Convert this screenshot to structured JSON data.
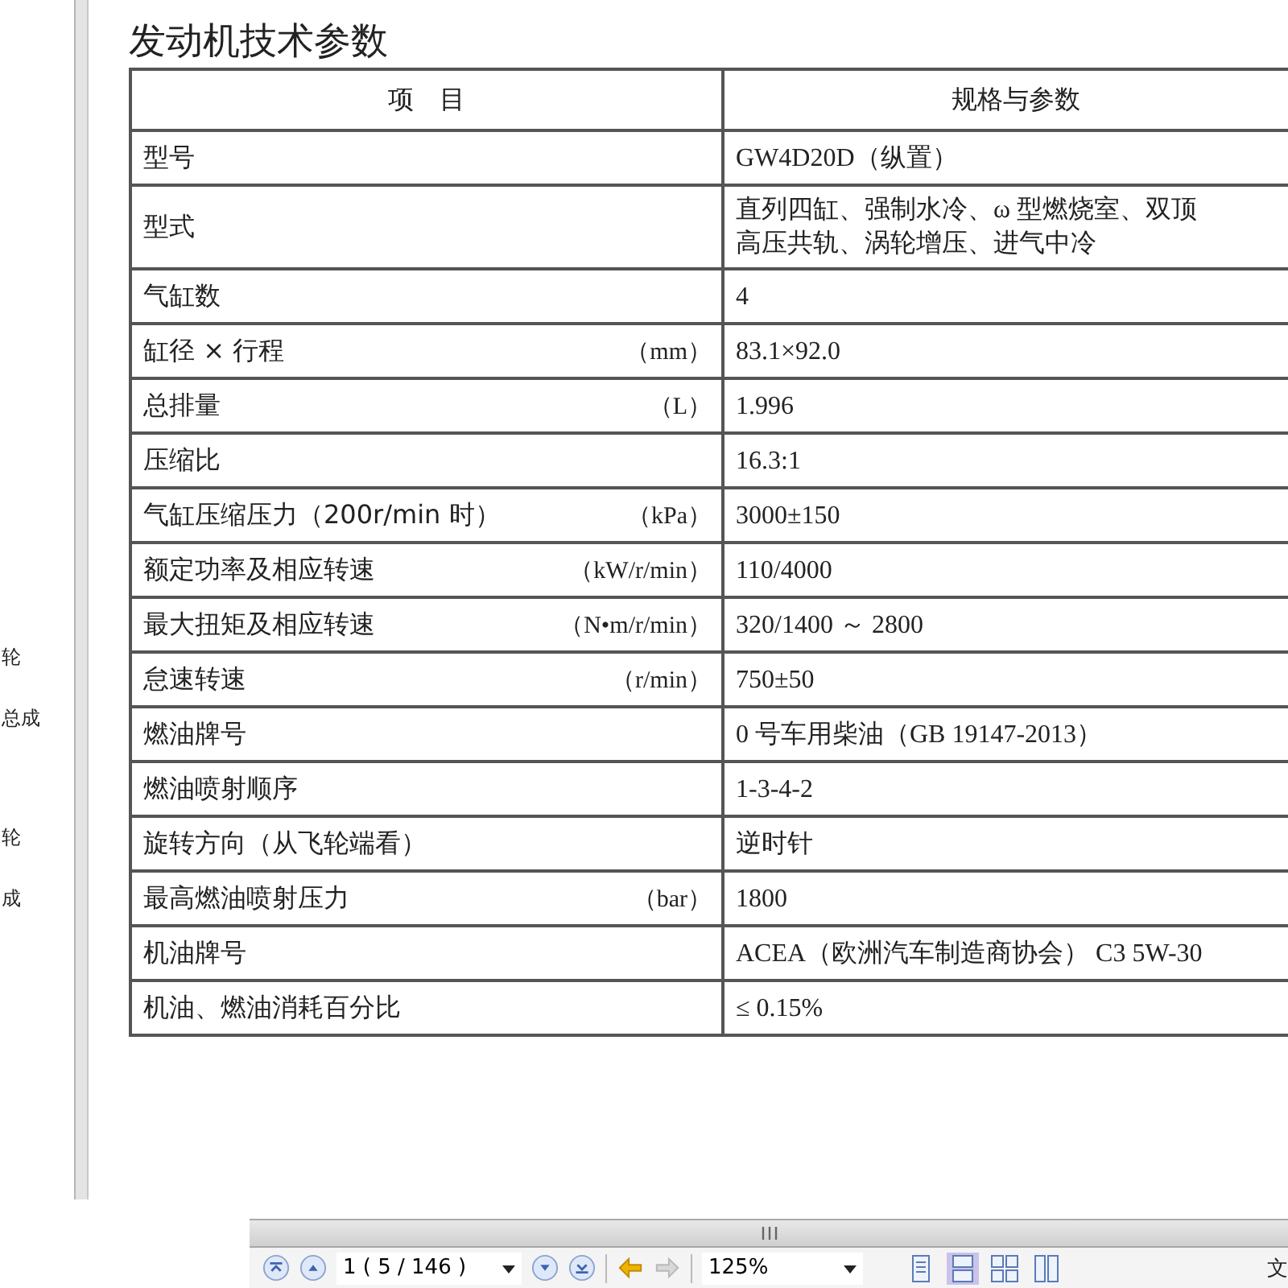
{
  "sidebar": {
    "items": [
      "轮",
      "总成",
      "轮",
      "成"
    ]
  },
  "document": {
    "heading": "发动机技术参数",
    "table": {
      "columns": [
        "项　目",
        "规格与参数"
      ],
      "rows": [
        {
          "item": "型号",
          "value": "GW4D20D（纵置）"
        },
        {
          "item": "型式",
          "value_lines": [
            "直列四缸、强制水冷、ω 型燃烧室、双顶",
            "高压共轨、涡轮增压、进气中冷"
          ]
        },
        {
          "item": "气缸数",
          "value": "4"
        },
        {
          "item": "缸径 × 行程",
          "unit": "（mm）",
          "value": "83.1×92.0"
        },
        {
          "item": "总排量",
          "unit": "（L）",
          "value": "1.996"
        },
        {
          "item": "压缩比",
          "value": "16.3:1"
        },
        {
          "item": "气缸压缩压力（200r/min 时）",
          "unit": "（kPa）",
          "value": "3000±150"
        },
        {
          "item": "额定功率及相应转速",
          "unit": "（kW/r/min）",
          "value": "110/4000"
        },
        {
          "item": "最大扭矩及相应转速",
          "unit": "（N•m/r/min）",
          "value": "320/1400 ～ 2800"
        },
        {
          "item": "怠速转速",
          "unit": "（r/min）",
          "value": "750±50"
        },
        {
          "item": "燃油牌号",
          "value": "0 号车用柴油（GB 19147-2013）"
        },
        {
          "item": "燃油喷射顺序",
          "value": "1-3-4-2"
        },
        {
          "item": "旋转方向（从飞轮端看）",
          "value": "逆时针"
        },
        {
          "item": "最高燃油喷射压力",
          "unit": "（bar）",
          "value": "1800"
        },
        {
          "item": "机油牌号",
          "value": "ACEA（欧洲汽车制造商协会） C3 5W-30"
        },
        {
          "item": "机油、燃油消耗百分比",
          "value": "≤ 0.15%"
        }
      ]
    }
  },
  "toolbar": {
    "page_field": "1 ( 5 / 146 )",
    "history": [
      {
        "disabled": false
      },
      {
        "disabled": true
      }
    ],
    "zoom_field": "125%",
    "view_modes": [
      {
        "kind": "single",
        "selected": false
      },
      {
        "kind": "continuous",
        "selected": true
      },
      {
        "kind": "grid",
        "selected": false
      },
      {
        "kind": "columns",
        "selected": false
      }
    ],
    "menu_label": "文"
  }
}
